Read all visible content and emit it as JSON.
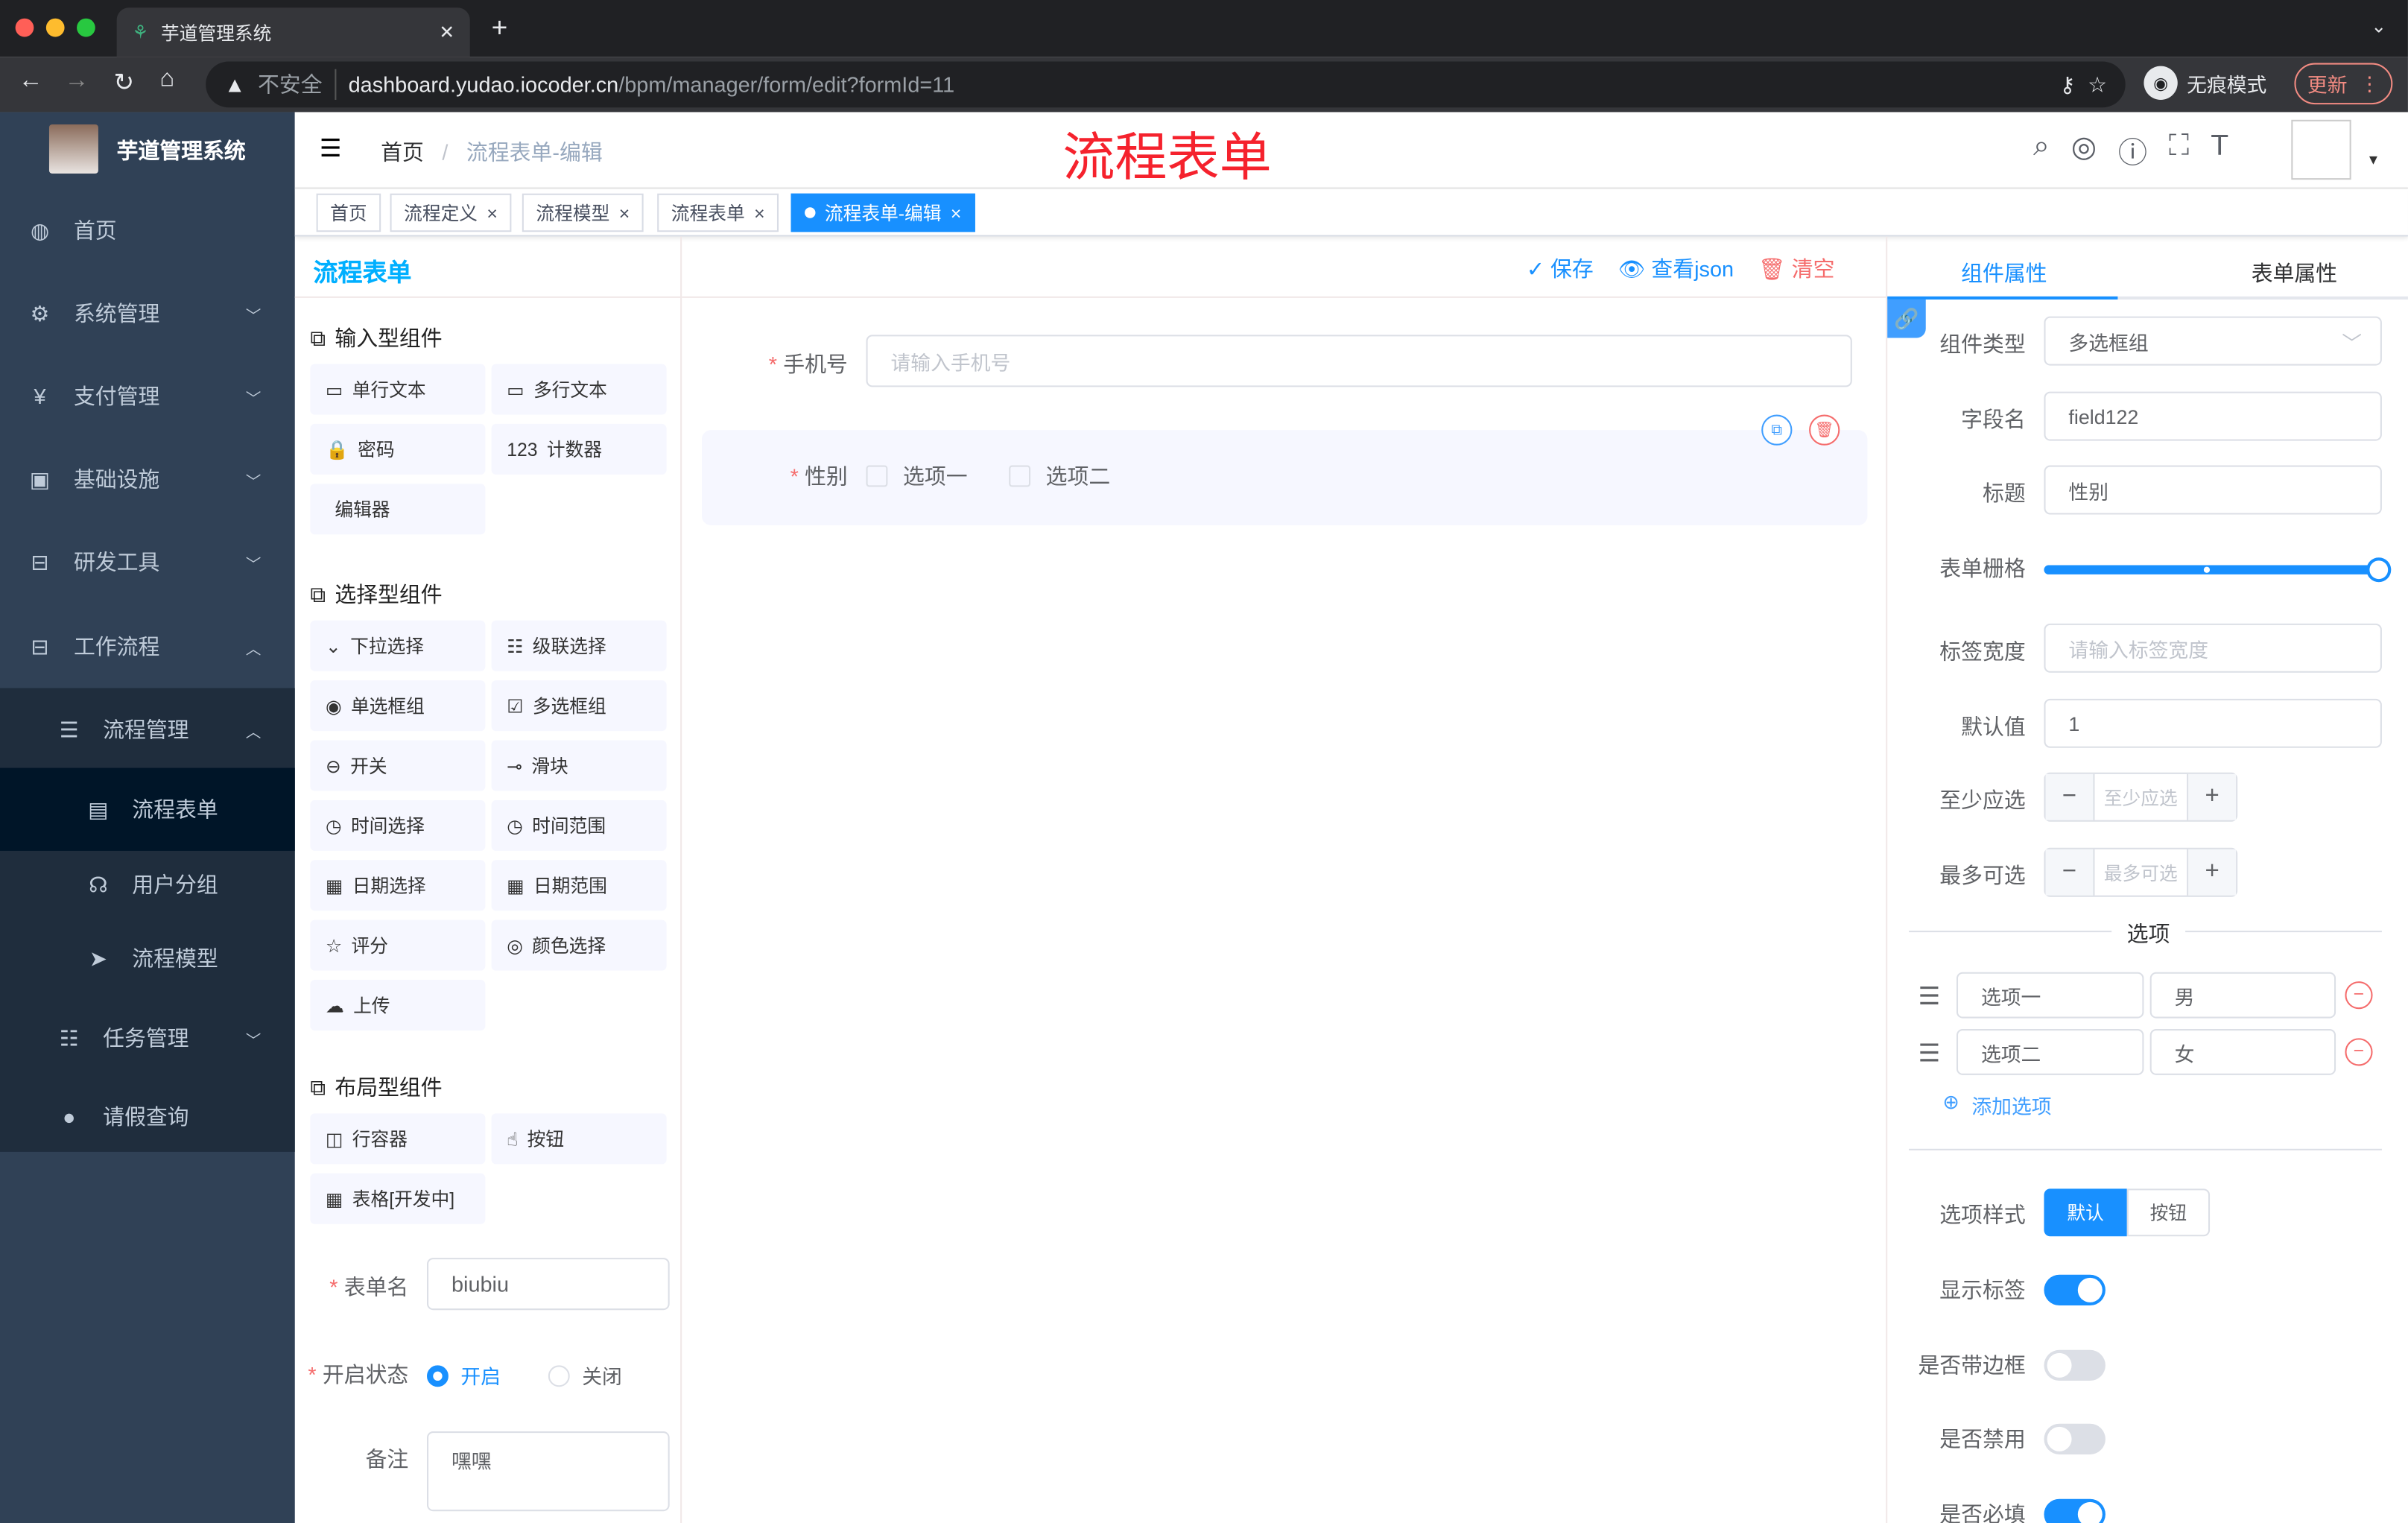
{
  "browser": {
    "tab_title": "芋道管理系统",
    "insecure_label": "不安全",
    "url_host": "dashboard.yudao.iocoder.cn",
    "url_path": "/bpm/manager/form/edit?formId=11",
    "incognito_label": "无痕模式",
    "update_label": "更新"
  },
  "app": {
    "name": "芋道管理系统",
    "page_title_overlay": "流程表单",
    "accent": "#1890ff",
    "sidebar_bg": "#304156"
  },
  "sidebar": {
    "items": [
      {
        "label": "首页",
        "icon": "dashboard-icon"
      },
      {
        "label": "系统管理",
        "icon": "gear-icon"
      },
      {
        "label": "支付管理",
        "icon": "yen-icon"
      },
      {
        "label": "基础设施",
        "icon": "monitor-icon"
      },
      {
        "label": "研发工具",
        "icon": "toolbox-icon"
      },
      {
        "label": "工作流程",
        "icon": "toolbox-icon"
      },
      {
        "label": "流程管理",
        "icon": "tree-icon"
      },
      {
        "label": "流程表单",
        "icon": "form-icon"
      },
      {
        "label": "用户分组",
        "icon": "group-icon"
      },
      {
        "label": "流程模型",
        "icon": "send-icon"
      },
      {
        "label": "任务管理",
        "icon": "tree-icon"
      },
      {
        "label": "请假查询",
        "icon": "user-icon"
      }
    ]
  },
  "breadcrumb": {
    "home": "首页",
    "current": "流程表单-编辑"
  },
  "tags": [
    "首页",
    "流程定义",
    "流程模型",
    "流程表单",
    "流程表单-编辑"
  ],
  "toolbar": {
    "title": "流程表单",
    "save": "保存",
    "view_json": "查看json",
    "clear": "清空"
  },
  "palette": {
    "input_title": "输入型组件",
    "input": [
      "单行文本",
      "多行文本",
      "密码",
      "计数器",
      "编辑器"
    ],
    "select_title": "选择型组件",
    "select": [
      "下拉选择",
      "级联选择",
      "单选框组",
      "多选框组",
      "开关",
      "滑块",
      "时间选择",
      "时间范围",
      "日期选择",
      "日期范围",
      "评分",
      "颜色选择",
      "上传"
    ],
    "layout_title": "布局型组件",
    "layout": [
      "行容器",
      "按钮",
      "表格[开发中]"
    ]
  },
  "form_meta": {
    "name_label": "表单名",
    "name_value": "biubiu",
    "status_label": "开启状态",
    "status_on": "开启",
    "status_off": "关闭",
    "remark_label": "备注",
    "remark_value": "嘿嘿"
  },
  "canvas": {
    "phone_label": "手机号",
    "phone_placeholder": "请输入手机号",
    "gender_label": "性别",
    "options": [
      "选项一",
      "选项二"
    ]
  },
  "props": {
    "tab_component": "组件属性",
    "tab_form": "表单属性",
    "type_label": "组件类型",
    "type_value": "多选框组",
    "field_label": "字段名",
    "field_value": "field122",
    "title_label": "标题",
    "title_value": "性别",
    "grid_label": "表单栅格",
    "grid_value": 24,
    "grid_max": 24,
    "label_width_label": "标签宽度",
    "label_width_placeholder": "请输入标签宽度",
    "default_label": "默认值",
    "default_value": "1",
    "min_label": "至少应选",
    "min_placeholder": "至少应选",
    "max_label": "最多可选",
    "max_placeholder": "最多可选",
    "options_title": "选项",
    "options": [
      {
        "label": "选项一",
        "value": "男"
      },
      {
        "label": "选项二",
        "value": "女"
      }
    ],
    "add_option": "添加选项",
    "style_label": "选项样式",
    "style_default": "默认",
    "style_button": "按钮",
    "show_label": "显示标签",
    "show_label_on": true,
    "border_label": "是否带边框",
    "border_on": false,
    "disabled_label": "是否禁用",
    "disabled_on": false,
    "required_label": "是否必填",
    "required_on": true
  }
}
